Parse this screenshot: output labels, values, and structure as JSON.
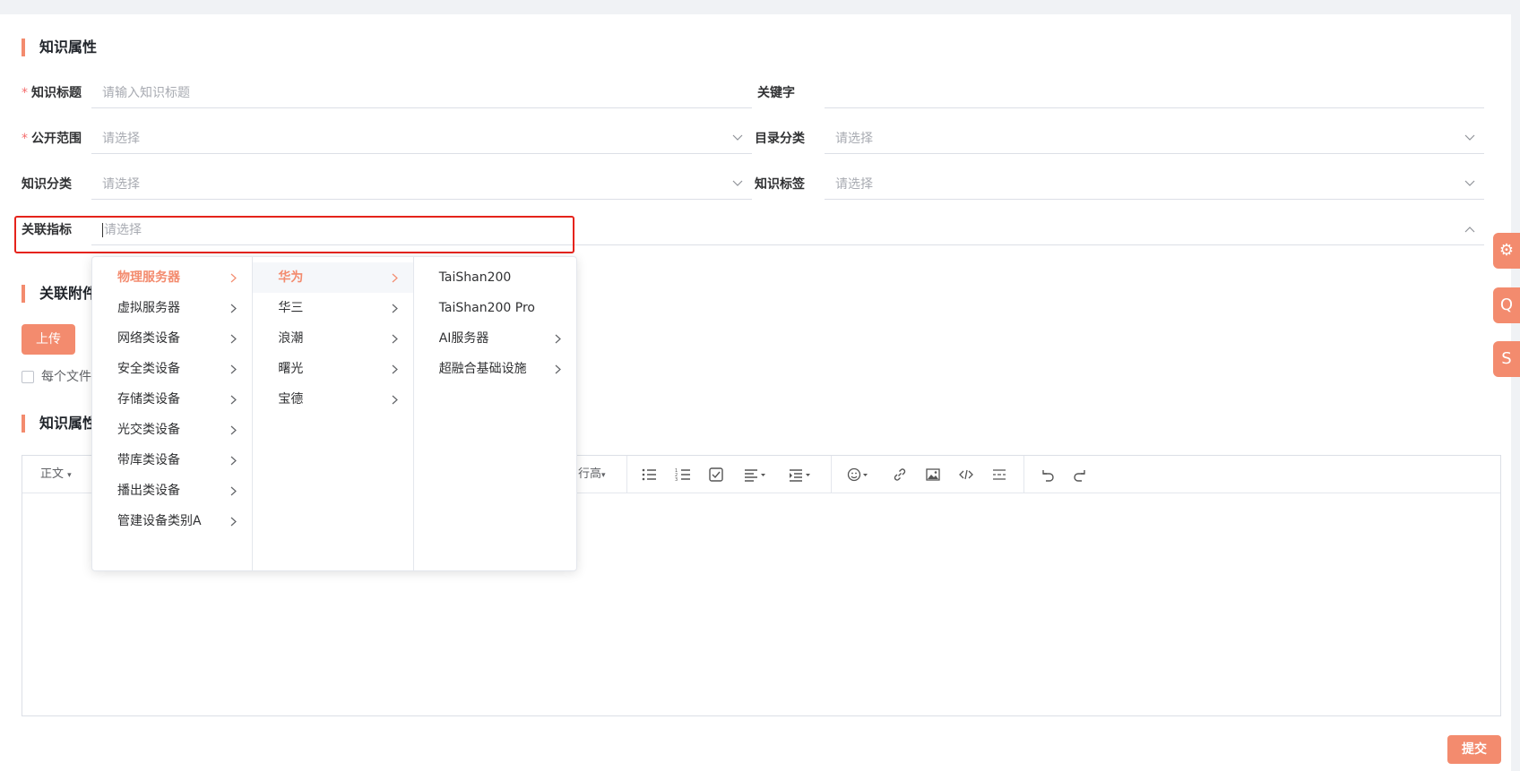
{
  "section1": {
    "title": "知识属性"
  },
  "fields": {
    "title_label": "知识标题",
    "title_placeholder": "请输入知识标题",
    "keyword_label": "关键字",
    "scope_label": "公开范围",
    "scope_placeholder": "请选择",
    "catalog_label": "目录分类",
    "catalog_placeholder": "请选择",
    "category_label": "知识分类",
    "category_placeholder": "请选择",
    "tag_label": "知识标签",
    "tag_placeholder": "请选择",
    "metric_label": "关联指标",
    "metric_placeholder": "请选择",
    "required_mark": "*"
  },
  "section2": {
    "title": "关联附件"
  },
  "upload": {
    "button_label": "上传",
    "checkbox_label": "每个文件"
  },
  "section3": {
    "title": "知识属性"
  },
  "editor": {
    "paragraph_label": "正文",
    "line_height_label": "行高"
  },
  "submit": {
    "label": "提交"
  },
  "side_buttons": [
    "⚙",
    "Q",
    "S"
  ],
  "cascader": {
    "col1": [
      {
        "label": "物理服务器",
        "active": true
      },
      {
        "label": "虚拟服务器"
      },
      {
        "label": "网络类设备"
      },
      {
        "label": "安全类设备"
      },
      {
        "label": "存储类设备"
      },
      {
        "label": "光交类设备"
      },
      {
        "label": "带库类设备"
      },
      {
        "label": "播出类设备"
      },
      {
        "label": "管建设备类别A"
      }
    ],
    "col2": [
      {
        "label": "华为",
        "active": true
      },
      {
        "label": "华三"
      },
      {
        "label": "浪潮"
      },
      {
        "label": "曙光"
      },
      {
        "label": "宝德"
      }
    ],
    "col3": [
      {
        "label": "TaiShan200"
      },
      {
        "label": "TaiShan200 Pro"
      },
      {
        "label": "AI服务器"
      },
      {
        "label": "超融合基础设施"
      }
    ]
  },
  "colors": {
    "accent": "#f38b6e",
    "highlight": "#e5231b",
    "required": "#f56c6c"
  }
}
